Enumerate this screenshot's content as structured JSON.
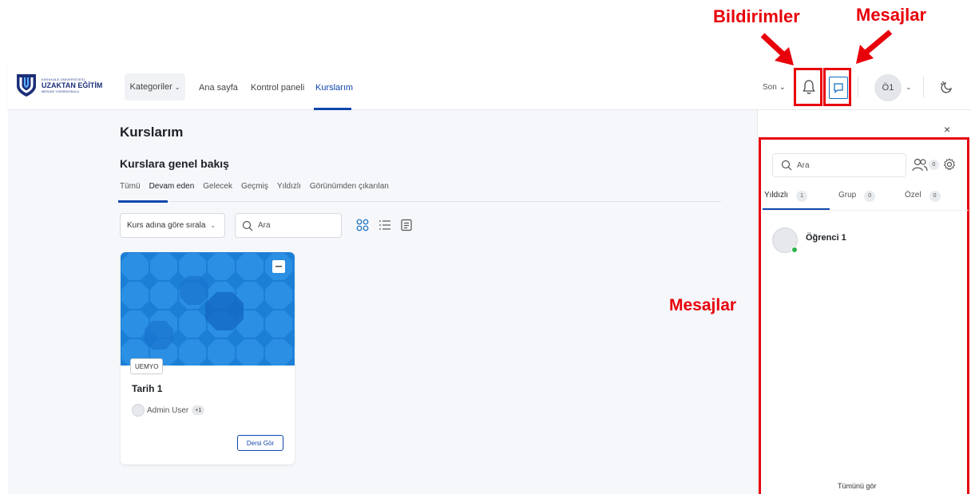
{
  "annotations": {
    "bildirimler": "Bildirimler",
    "mesajlar_top": "Mesajlar",
    "mesajlar_side": "Mesajlar"
  },
  "navbar": {
    "logo": {
      "top_line": "KIRIKKALE ÜNİVERSİTESİ",
      "main": "UZAKTAN EĞİTİM",
      "sub": "MESLEK YÜKSEKOKULU"
    },
    "categories_label": "Kategoriler",
    "links": {
      "home": "Ana sayfa",
      "dashboard": "Kontrol paneli",
      "my_courses": "Kurslarım"
    },
    "recent_label": "Son",
    "user_initials": "Ö1"
  },
  "main": {
    "page_title": "Kurslarım",
    "section_title": "Kurslara genel bakış",
    "filter_tabs": [
      "Tümü",
      "Devam eden",
      "Gelecek",
      "Geçmiş",
      "Yıldızlı",
      "Görünümden çıkarılan"
    ],
    "active_tab": "Devam eden",
    "sort_label": "Kurs adına göre sırala",
    "search_placeholder": "Ara",
    "course_card": {
      "category": "UEMYO",
      "title": "Tarih 1",
      "teacher": "Admin User",
      "more_teachers": "+1",
      "view_button": "Dersi Gör"
    }
  },
  "drawer": {
    "close": "×",
    "search_placeholder": "Ara",
    "contact_requests": "0",
    "tabs": [
      {
        "label": "Yıldızlı",
        "count": "1"
      },
      {
        "label": "Grup",
        "count": "0"
      },
      {
        "label": "Özel",
        "count": "0"
      }
    ],
    "contact_name": "Öğrenci 1",
    "view_all": "Tümünü gör"
  },
  "colors": {
    "accent": "#0f47ad",
    "annotation": "#e8000b",
    "online": "#2bb34a"
  }
}
